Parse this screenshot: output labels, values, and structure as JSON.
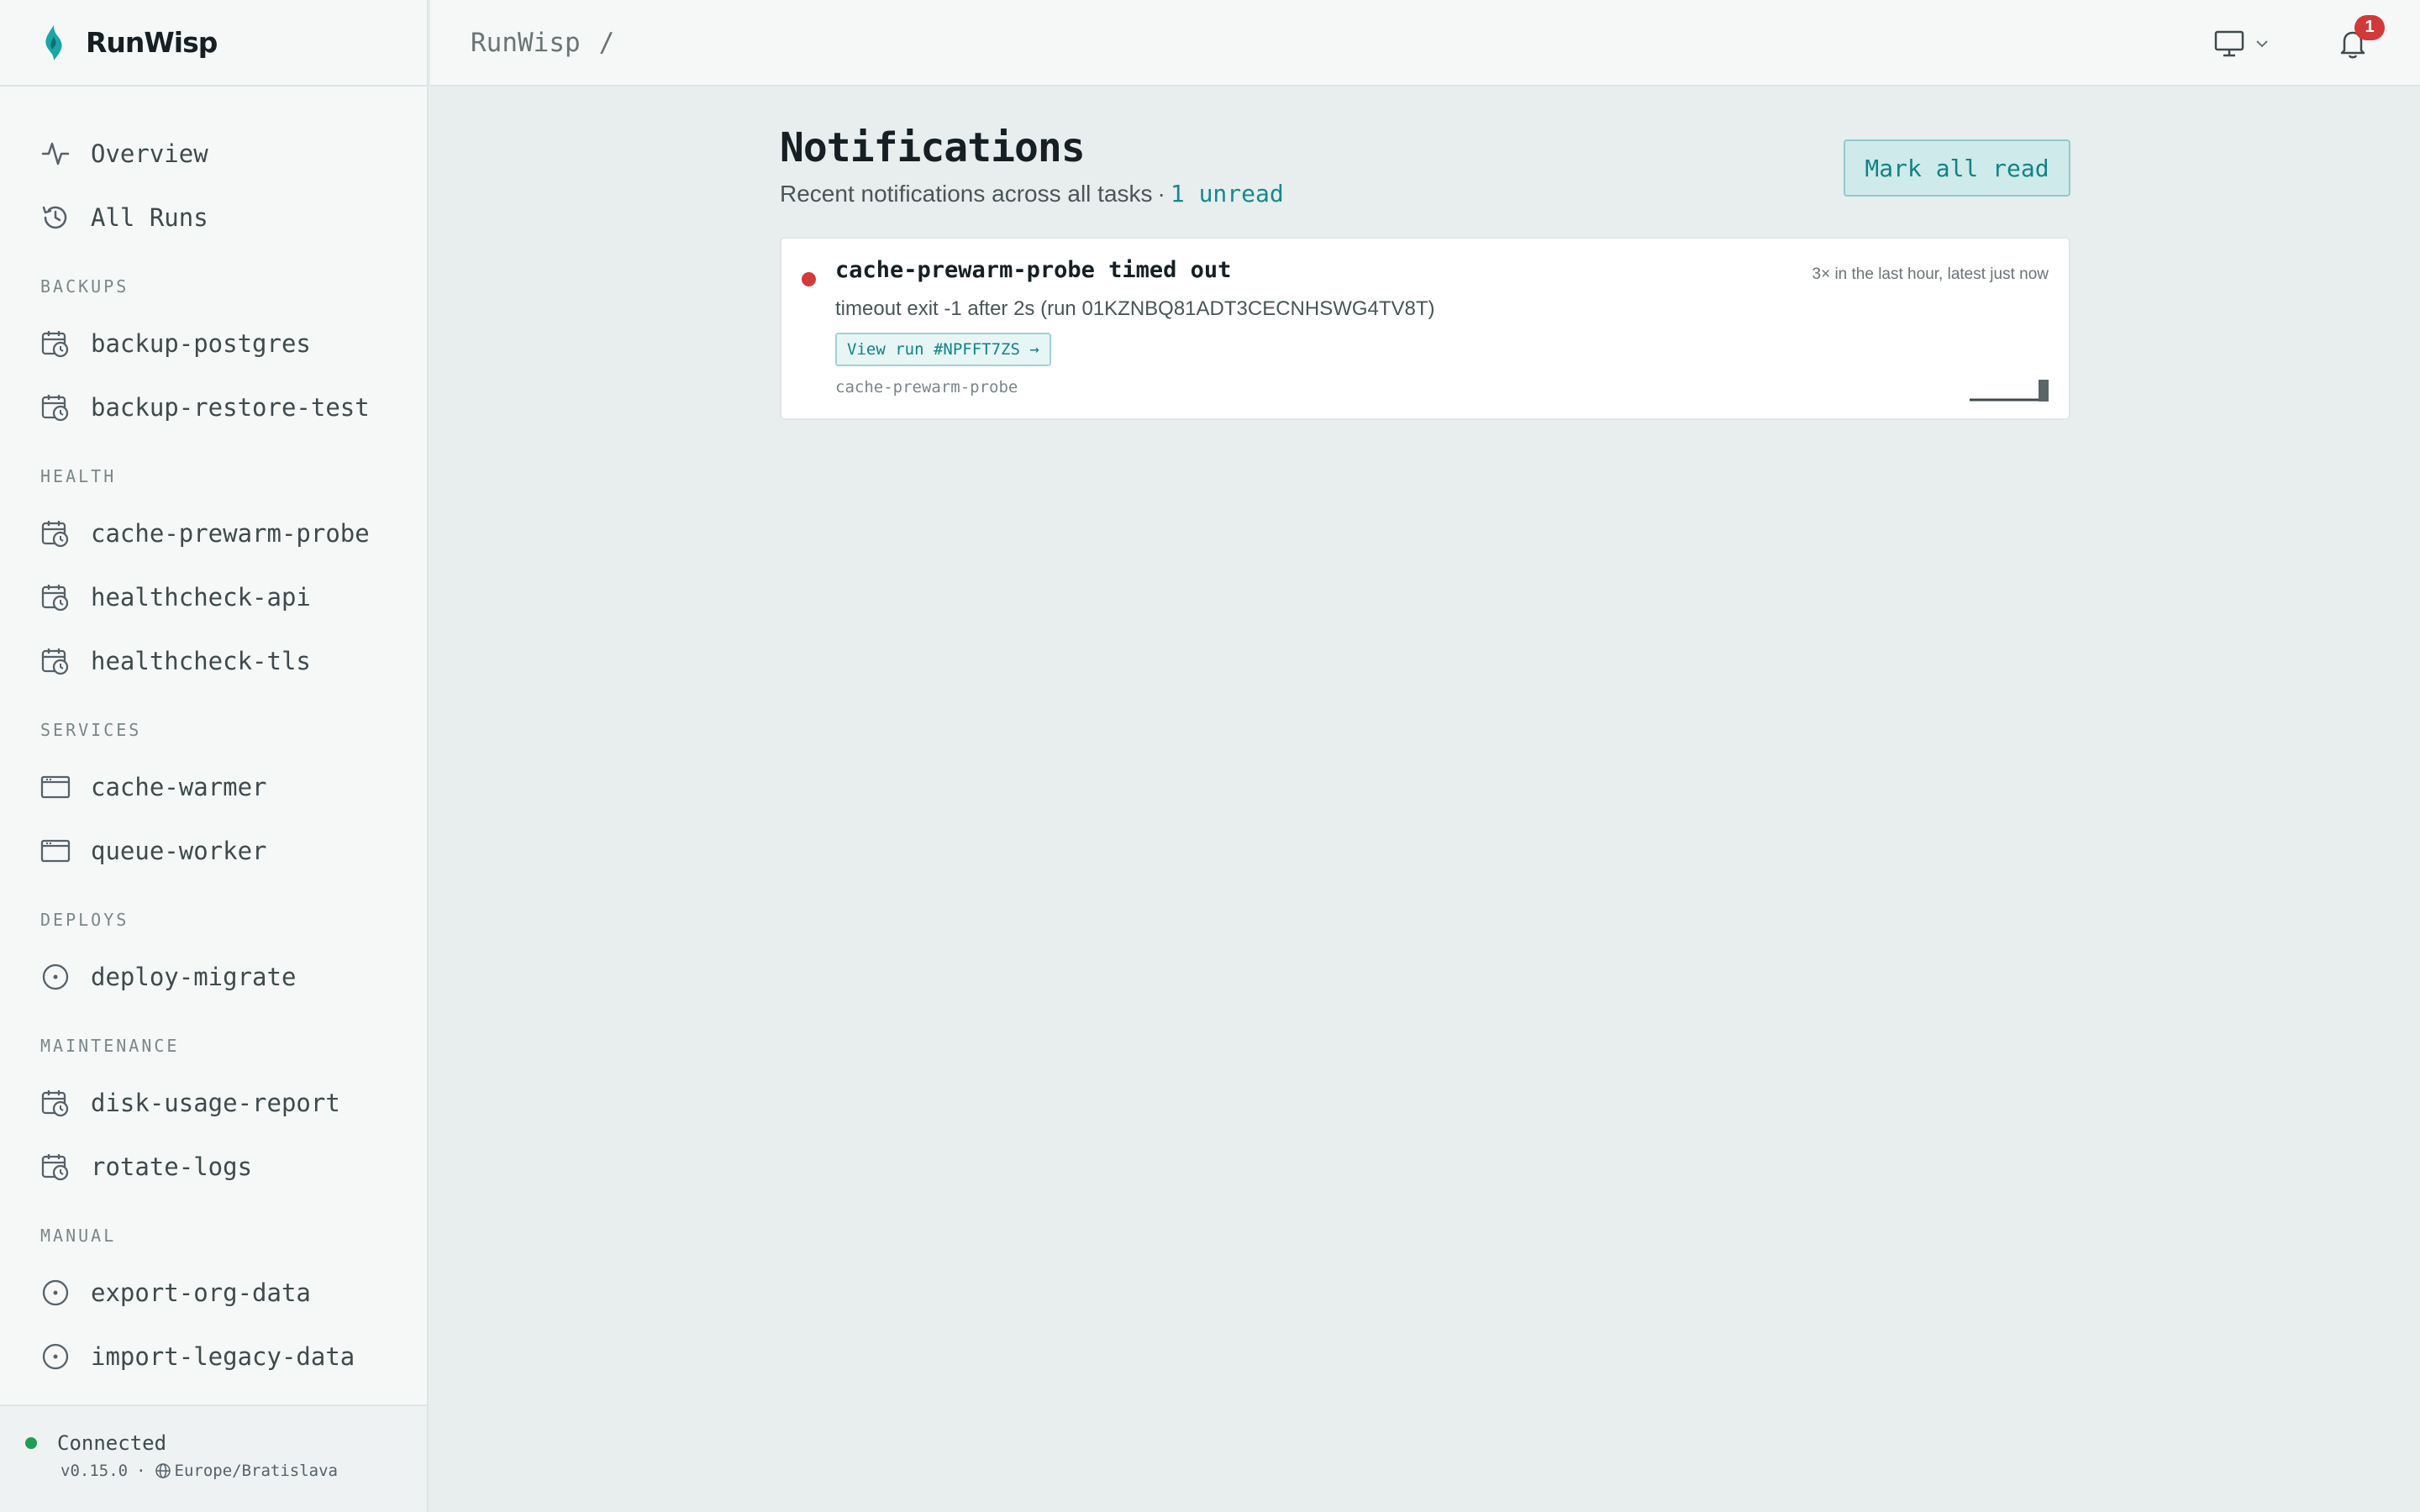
{
  "brand": {
    "name": "RunWisp"
  },
  "nav": {
    "primary": [
      {
        "label": "Overview",
        "icon": "activity-icon"
      },
      {
        "label": "All Runs",
        "icon": "history-icon"
      }
    ],
    "sections": [
      {
        "title": "BACKUPS",
        "items": [
          {
            "label": "backup-postgres",
            "icon": "calendar-clock-icon"
          },
          {
            "label": "backup-restore-test",
            "icon": "calendar-clock-icon"
          }
        ]
      },
      {
        "title": "HEALTH",
        "items": [
          {
            "label": "cache-prewarm-probe",
            "icon": "calendar-clock-icon"
          },
          {
            "label": "healthcheck-api",
            "icon": "calendar-clock-icon"
          },
          {
            "label": "healthcheck-tls",
            "icon": "calendar-clock-icon"
          }
        ]
      },
      {
        "title": "SERVICES",
        "items": [
          {
            "label": "cache-warmer",
            "icon": "window-icon"
          },
          {
            "label": "queue-worker",
            "icon": "window-icon"
          }
        ]
      },
      {
        "title": "DEPLOYS",
        "items": [
          {
            "label": "deploy-migrate",
            "icon": "circle-dot-icon"
          }
        ]
      },
      {
        "title": "MAINTENANCE",
        "items": [
          {
            "label": "disk-usage-report",
            "icon": "calendar-clock-icon"
          },
          {
            "label": "rotate-logs",
            "icon": "calendar-clock-icon"
          }
        ]
      },
      {
        "title": "MANUAL",
        "items": [
          {
            "label": "export-org-data",
            "icon": "circle-dot-icon"
          },
          {
            "label": "import-legacy-data",
            "icon": "circle-dot-icon"
          }
        ]
      }
    ]
  },
  "footer": {
    "status": "Connected",
    "version": "v0.15.0",
    "separator": "·",
    "timezone": "Europe/Bratislava",
    "status_color": "#1f9d55"
  },
  "topbar": {
    "breadcrumb": "RunWisp",
    "breadcrumb_sep": "/",
    "notification_count": "1"
  },
  "page": {
    "title": "Notifications",
    "subtitle": "Recent notifications across all tasks",
    "subtitle_sep": "·",
    "unread_text": "1 unread",
    "mark_all_label": "Mark all read"
  },
  "notifications": [
    {
      "title": "cache-prewarm-probe timed out",
      "time": "3× in the last hour, latest just now",
      "body": "timeout exit -1 after 2s (run 01KZNBQ81ADT3CECNHSWG4TV8T)",
      "link_label": "View run #NPFFT7ZS →",
      "task": "cache-prewarm-probe",
      "status_color": "#d23a3a"
    }
  ],
  "colors": {
    "accent": "#138a8c",
    "danger": "#d23a3a",
    "success": "#1f9d55"
  }
}
